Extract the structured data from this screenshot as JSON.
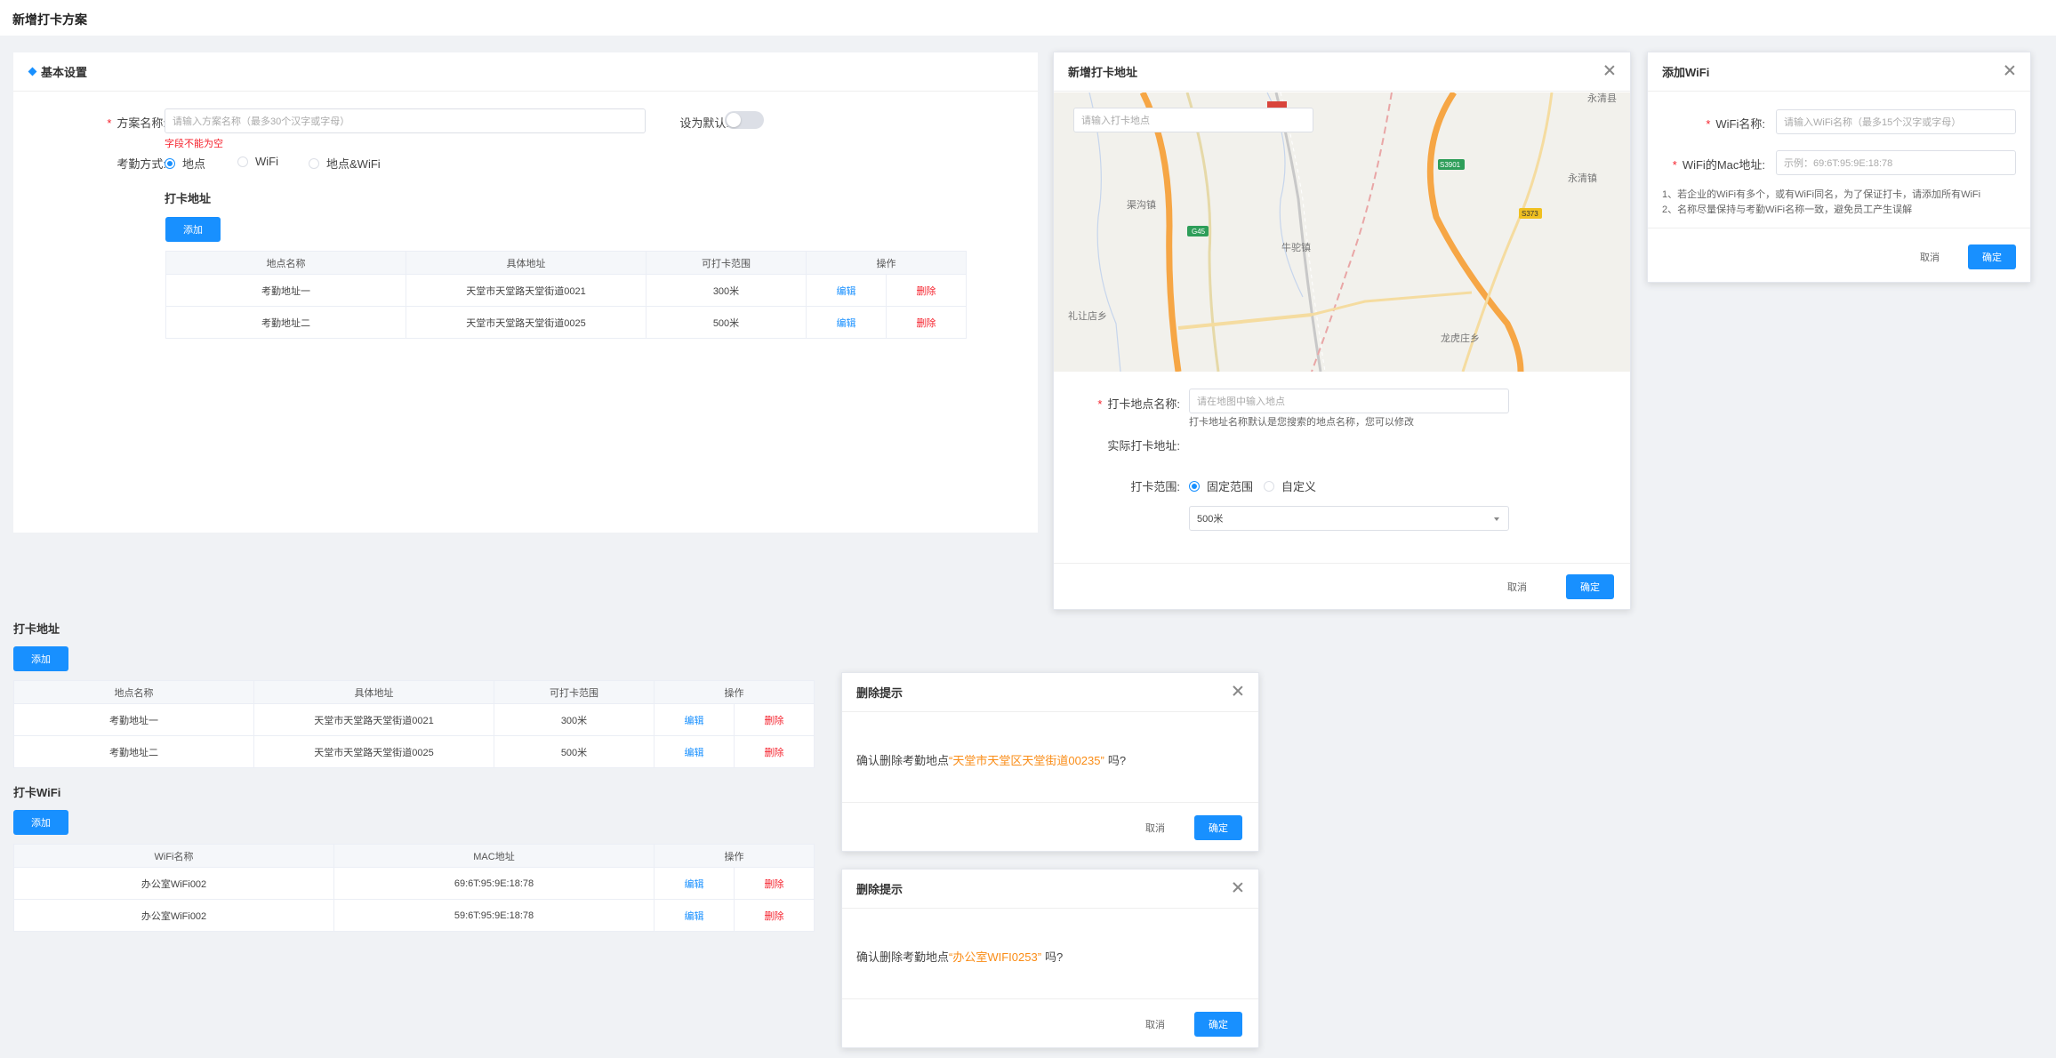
{
  "page": {
    "title": "新增打卡方案"
  },
  "basic": {
    "header": "基本设置",
    "scheme_label": "方案名称:",
    "scheme_placeholder": "请输入方案名称（最多30个汉字或字母）",
    "error": "字段不能为空",
    "default_label": "设为默认:",
    "default_on": false,
    "method_label": "考勤方式:",
    "methods": [
      "地点",
      "WiFi",
      "地点&WiFi"
    ],
    "method_selected": "地点",
    "address_title": "打卡地址",
    "add_label": "添加",
    "table": {
      "headers": [
        "地点名称",
        "具体地址",
        "可打卡范围",
        "操作"
      ],
      "rows": [
        {
          "name": "考勤地址一",
          "address": "天堂市天堂路天堂街道0021",
          "range": "300米",
          "edit": "编辑",
          "del": "删除"
        },
        {
          "name": "考勤地址二",
          "address": "天堂市天堂路天堂街道0025",
          "range": "500米",
          "edit": "编辑",
          "del": "删除"
        }
      ]
    }
  },
  "address_dialog": {
    "title": "新增打卡地址",
    "search_placeholder": "请输入打卡地点",
    "map_labels": [
      "永清县",
      "渠沟镇",
      "永清镇",
      "牛驼镇",
      "礼让店乡",
      "龙虎庄乡",
      "G45",
      "S3901",
      "S373"
    ],
    "name_label": "打卡地点名称:",
    "name_placeholder": "请在地图中输入地点",
    "name_hint": "打卡地址名称默认是您搜索的地点名称，您可以修改",
    "actual_label": "实际打卡地址:",
    "range_label": "打卡范围:",
    "range_options": [
      "固定范围",
      "自定义"
    ],
    "range_selected": "固定范围",
    "range_value": "500米",
    "cancel": "取消",
    "ok": "确定"
  },
  "wifi_dialog": {
    "title": "添加WiFi",
    "name_label": "WiFi名称:",
    "name_placeholder": "请输入WiFi名称（最多15个汉字或字母）",
    "mac_label": "WiFi的Mac地址:",
    "mac_placeholder": "示例：69:6T:95:9E:18:78",
    "notes": [
      "1、若企业的WiFi有多个，或有WiFi同名，为了保证打卡，请添加所有WiFi",
      "2、名称尽量保持与考勤WiFi名称一致，避免员工产生误解"
    ],
    "cancel": "取消",
    "ok": "确定"
  },
  "lower": {
    "address_title": "打卡地址",
    "add_label": "添加",
    "address_table": {
      "headers": [
        "地点名称",
        "具体地址",
        "可打卡范围",
        "操作"
      ],
      "rows": [
        {
          "name": "考勤地址一",
          "address": "天堂市天堂路天堂街道0021",
          "range": "300米",
          "edit": "编辑",
          "del": "删除"
        },
        {
          "name": "考勤地址二",
          "address": "天堂市天堂路天堂街道0025",
          "range": "500米",
          "edit": "编辑",
          "del": "删除"
        }
      ]
    },
    "wifi_title": "打卡WiFi",
    "wifi_table": {
      "headers": [
        "WiFi名称",
        "MAC地址",
        "操作"
      ],
      "rows": [
        {
          "name": "办公室WiFi002",
          "mac": "69:6T:95:9E:18:78",
          "edit": "编辑",
          "del": "删除"
        },
        {
          "name": "办公室WiFi002",
          "mac": "59:6T:95:9E:18:78",
          "edit": "编辑",
          "del": "删除"
        }
      ]
    }
  },
  "delete_dialog_1": {
    "title": "删除提示",
    "prefix": "确认删除考勤地点",
    "target": "“天堂市天堂区天堂街道00235”",
    "suffix": "吗?",
    "cancel": "取消",
    "ok": "确定"
  },
  "delete_dialog_2": {
    "title": "删除提示",
    "prefix": "确认删除考勤地点",
    "target": "“办公室WIFI0253”",
    "suffix": "吗?",
    "cancel": "取消",
    "ok": "确定"
  },
  "colors": {
    "primary": "#1890ff",
    "danger": "#f5222d",
    "highlight": "#fa8c16",
    "background": "#f0f2f5"
  }
}
